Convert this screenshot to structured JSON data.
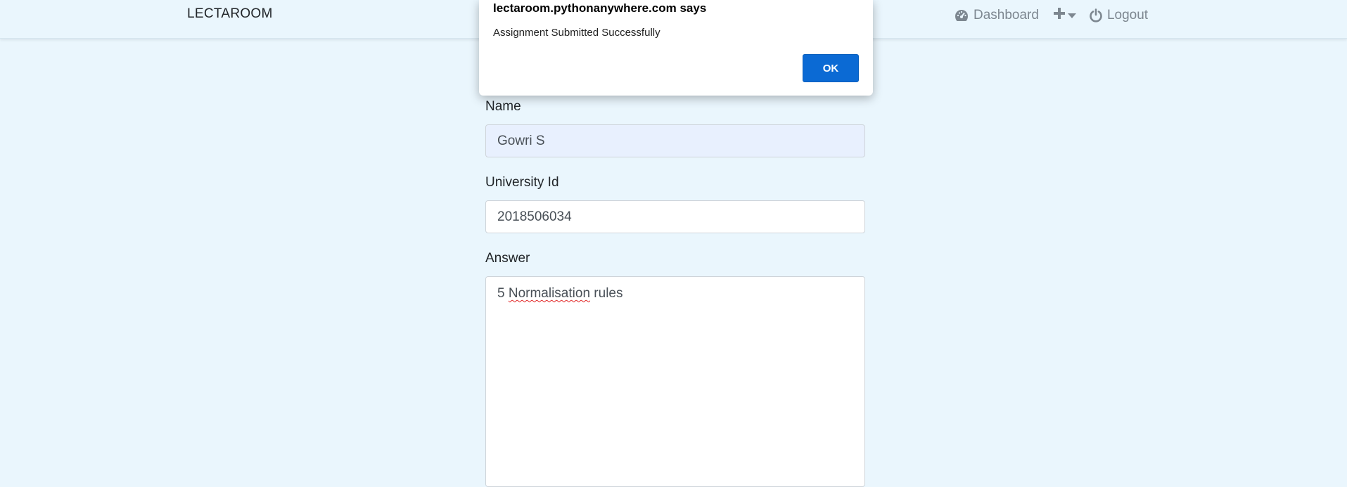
{
  "navbar": {
    "brand": "LECTAROOM",
    "links": {
      "dashboard_icon": "speedometer-icon",
      "dashboard": "Dashboard",
      "add_icon": "plus-icon",
      "logout_icon": "power-icon",
      "logout": "Logout"
    }
  },
  "form": {
    "name_label": "Name",
    "name_value": "Gowri S",
    "university_label": "University Id",
    "university_value": "2018506034",
    "answer_label": "Answer",
    "answer_prefix": "5",
    "answer_misspelled": "Normalisation",
    "answer_suffix": "rules"
  },
  "dialog": {
    "title": "lectaroom.pythonanywhere.com says",
    "message": "Assignment Submitted Successfully",
    "ok_label": "OK"
  },
  "colors": {
    "page_bg": "#eaf6fd",
    "primary_button": "#0b6ad4",
    "autofill_bg": "#e8f0fe"
  }
}
